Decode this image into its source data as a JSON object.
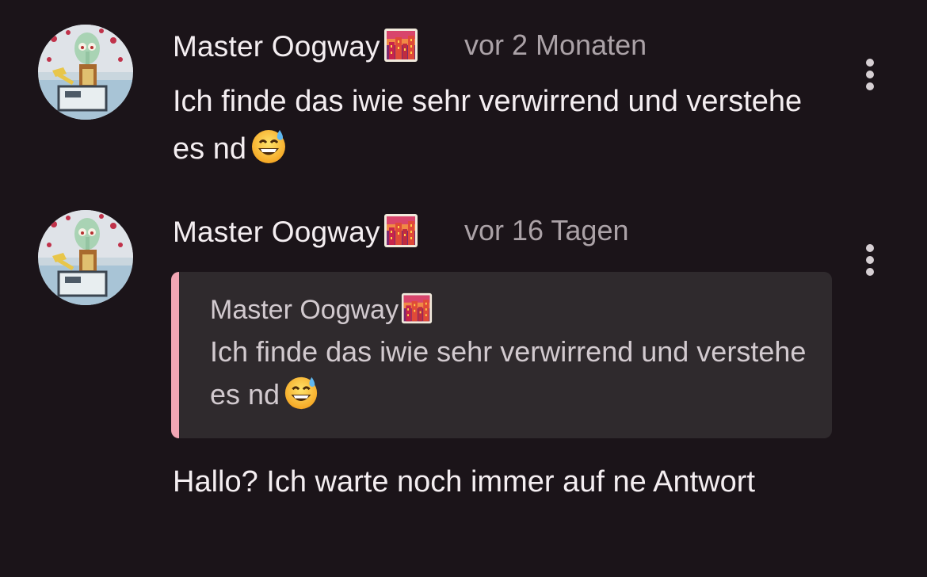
{
  "comments": [
    {
      "author": "Master Oogway",
      "author_badge_icon": "city-sunset-emoji",
      "time": "vor 2 Monaten",
      "text": "Ich finde das iwie sehr verwirrend und verstehe es nd",
      "text_emoji_icon": "grinning-face-with-sweat-emoji"
    },
    {
      "author": "Master Oogway",
      "author_badge_icon": "city-sunset-emoji",
      "time": "vor 16 Tagen",
      "quote": {
        "author": "Master Oogway",
        "text": "Ich finde das iwie sehr verwirrend und verstehe es nd"
      },
      "text": "Hallo? Ich warte noch immer auf ne Antwort"
    }
  ],
  "icons": {
    "more_options": "vertical-ellipsis-icon"
  },
  "colors": {
    "background": "#1b1419",
    "text": "#f4eef1",
    "time": "#aba2a7",
    "quote_background": "#2f2a2d",
    "quote_accent": "#f2a6b4"
  }
}
